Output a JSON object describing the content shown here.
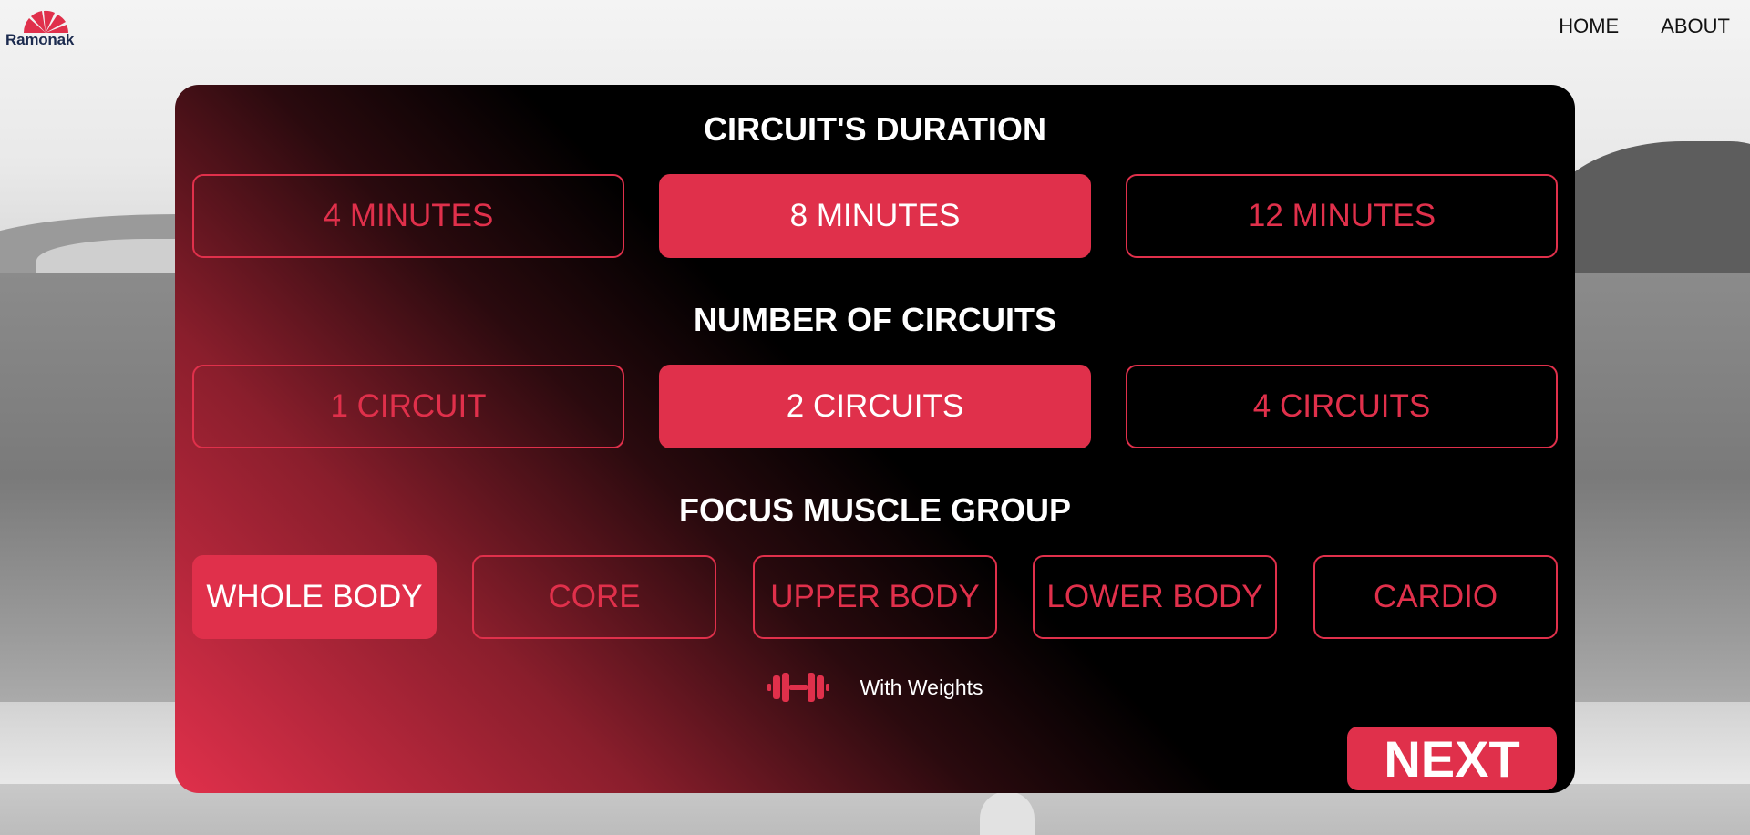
{
  "brand": {
    "name": "Ramonak",
    "accent": "#e0304b"
  },
  "nav": {
    "items": [
      "HOME",
      "ABOUT"
    ]
  },
  "duration": {
    "title": "CIRCUIT'S DURATION",
    "options": [
      "4 MINUTES",
      "8 MINUTES",
      "12 MINUTES"
    ],
    "selected": "8 MINUTES"
  },
  "circuits": {
    "title": "NUMBER OF CIRCUITS",
    "options": [
      "1 CIRCUIT",
      "2 CIRCUITS",
      "4 CIRCUITS"
    ],
    "selected": "2 CIRCUITS"
  },
  "focus": {
    "title": "FOCUS MUSCLE GROUP",
    "options": [
      "WHOLE BODY",
      "CORE",
      "UPPER BODY",
      "LOWER BODY",
      "CARDIO"
    ],
    "selected": "WHOLE BODY"
  },
  "weights": {
    "label": "With Weights",
    "icon": "dumbbell-icon"
  },
  "next_label": "NEXT"
}
